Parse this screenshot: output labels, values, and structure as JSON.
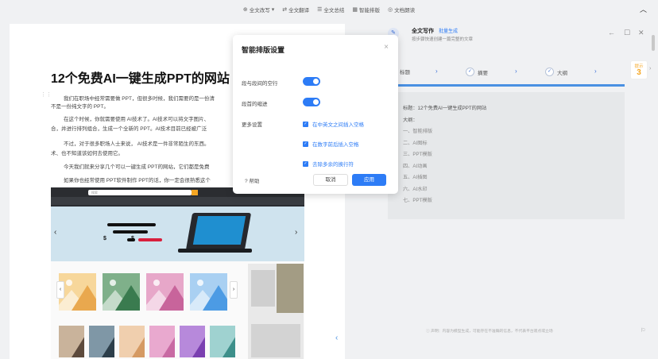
{
  "toolbar": {
    "items": [
      {
        "label": "全文改写",
        "icon": "rewrite-icon"
      },
      {
        "label": "全文翻译",
        "icon": "translate-icon"
      },
      {
        "label": "全文总结",
        "icon": "summary-icon"
      },
      {
        "label": "智能排版",
        "icon": "layout-icon"
      },
      {
        "label": "文档朗读",
        "icon": "read-aloud-icon"
      }
    ],
    "collapse_icon": "chevron-up-icon"
  },
  "document": {
    "title": "12个免费AI一键生成PPT的网站",
    "paragraphs": [
      "我们在职场中经常需要做 PPT，但很多时候，我们需要的是一份清",
      "不是一份纯文字的 PPT。",
      "在这个时候，你就需要使用 AI技术了。AI技术可以将文字图片、",
      "合，并进行排列组合，生成一个全新的 PPT。AI技术目前已经被广泛",
      "不过，对于很多职场人士来说， AI技术是一件非常陌生的东西。",
      "术、也不知道该如何去使用它。",
      "今天我们就来分享几个可以一键生成 PPT的网站，它们都是免费",
      "如果你也经常使用 PPT软件制作 PPT的话，你一定会很熟悉这个"
    ],
    "image_search_placeholder": "搜索"
  },
  "modal": {
    "title": "智能排版设置",
    "settings": [
      {
        "label": "段与段间的空行",
        "enabled": true
      },
      {
        "label": "段首的缩进",
        "enabled": true
      }
    ],
    "more_label": "更多设置",
    "options": [
      {
        "label": "在中英文之间插入空格",
        "checked": true
      },
      {
        "label": "在数字前后插入空格",
        "checked": true
      },
      {
        "label": "去除多余的换行符",
        "checked": true
      }
    ],
    "help_label": "帮助",
    "cancel_label": "取消",
    "apply_label": "应用"
  },
  "panel": {
    "title": "全文写作",
    "mode": "批量生成",
    "subtitle": "按步骤快速创建一篇完整的文章",
    "steps": [
      "标题",
      "摘要",
      "大纲"
    ],
    "tip_label": "提示",
    "tip_count": "3",
    "outline": {
      "title_line": "标题：12个免费AI一键生成PPT的网站",
      "heading": "大纲：",
      "items": [
        "一、智能排版",
        "二、AI图标",
        "三、PPT模版",
        "四、AI动画",
        "五、AI插图",
        "六、AI水印",
        "七、PPT模版"
      ]
    },
    "disclaimer": "声明：内容为模型生成，可能存在不准确的信息，不代表平台观点或立场"
  },
  "colors": {
    "accent": "#2d7cf6",
    "tip": "#f5a623",
    "progress": "#4a90e2"
  }
}
